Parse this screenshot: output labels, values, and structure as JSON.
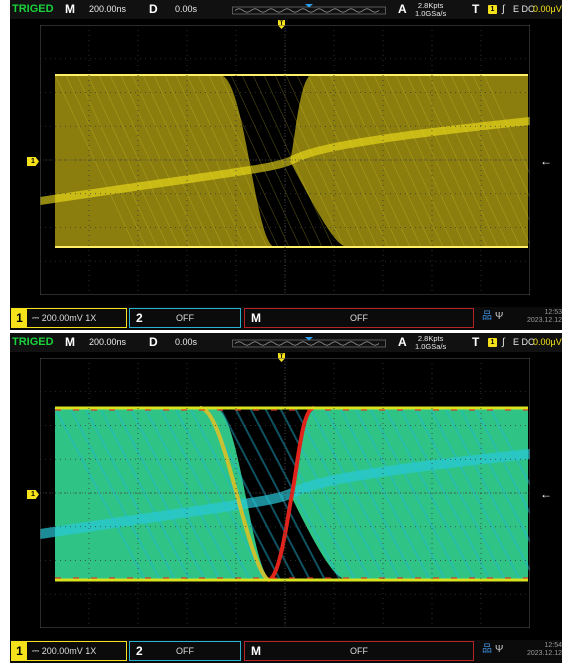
{
  "colors": {
    "ch1": "#f5e21a",
    "ch2": "#2ab4d4",
    "math": "#b52424",
    "triged": "#19d23a"
  },
  "screens": [
    {
      "mode": "normal",
      "top": {
        "status": "TRIGED",
        "m_label": "M",
        "timebase": "200.00ns",
        "d_label": "D",
        "delay": "0.00s",
        "a_label": "A",
        "mem_depth": "2.8Kpts",
        "sample_rate": "1.0GSa/s",
        "t_label": "T",
        "trig_source": "1",
        "trig_edge_icon": "rising-edge-icon",
        "trig_coupling": "E DC",
        "trig_level": "0.00μV"
      },
      "trig_pos_glyph": "T",
      "ch1_marker": "1",
      "trig_level_arrow": "←",
      "bottom": {
        "ch1_num": "1",
        "ch1_coupling_icon": "dc-coupling-icon",
        "ch1_scale": "200.00mV 1X",
        "ch2_num": "2",
        "ch2_state": "OFF",
        "math_label": "M",
        "math_state": "OFF",
        "net_icon": "network-icon",
        "usb_icon": "usb-icon",
        "time": "12:53",
        "date": "2023.12.12"
      }
    },
    {
      "mode": "color-grade",
      "top": {
        "status": "TRIGED",
        "m_label": "M",
        "timebase": "200.00ns",
        "d_label": "D",
        "delay": "0.00s",
        "a_label": "A",
        "mem_depth": "2.8Kpts",
        "sample_rate": "1.0GSa/s",
        "t_label": "T",
        "trig_source": "1",
        "trig_edge_icon": "rising-edge-icon",
        "trig_coupling": "E DC",
        "trig_level": "0.00μV"
      },
      "trig_pos_glyph": "T",
      "ch1_marker": "1",
      "trig_level_arrow": "←",
      "bottom": {
        "ch1_num": "1",
        "ch1_coupling_icon": "dc-coupling-icon",
        "ch1_scale": "200.00mV 1X",
        "ch2_num": "2",
        "ch2_state": "OFF",
        "math_label": "M",
        "math_state": "OFF",
        "net_icon": "network-icon",
        "usb_icon": "usb-icon",
        "time": "12:54",
        "date": "2023.12.12"
      }
    }
  ]
}
